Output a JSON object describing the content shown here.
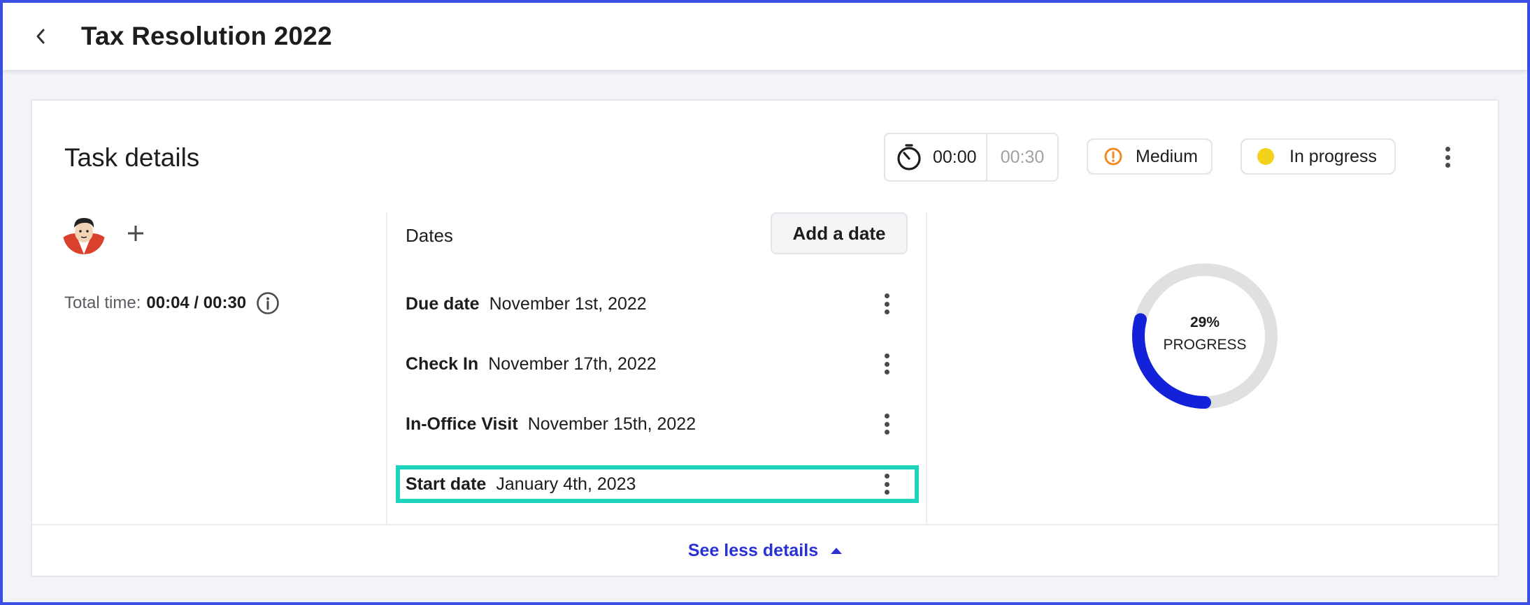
{
  "header": {
    "title": "Tax Resolution 2022"
  },
  "task": {
    "title": "Task details",
    "timer": {
      "elapsed": "00:00",
      "estimate": "00:30"
    },
    "priority": {
      "label": "Medium",
      "color": "#f08a24"
    },
    "status": {
      "label": "In progress",
      "color": "#f2d21a"
    },
    "total_time_label": "Total time:",
    "total_time_value": "00:04 / 00:30"
  },
  "dates": {
    "header": "Dates",
    "add_button": "Add a date",
    "items": [
      {
        "label": "Due date",
        "value": "November 1st, 2022"
      },
      {
        "label": "Check In",
        "value": "November 17th, 2022"
      },
      {
        "label": "In-Office Visit",
        "value": "November 15th, 2022"
      },
      {
        "label": "Start date",
        "value": "January 4th, 2023"
      }
    ]
  },
  "progress": {
    "percent": 29,
    "percent_label": "29%",
    "label": "PROGRESS",
    "color": "#1322d8"
  },
  "footer": {
    "toggle_label": "See less details"
  }
}
